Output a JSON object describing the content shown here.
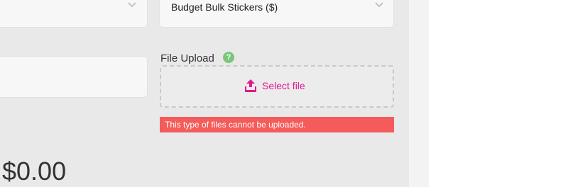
{
  "form": {
    "product_select": {
      "value": ""
    },
    "sticker_select": {
      "value": "Budget Bulk Stickers ($)"
    },
    "text_input": {
      "value": ""
    },
    "file_upload": {
      "label": "File Upload",
      "help_glyph": "?",
      "button_label": "Select file",
      "error": "This type of files cannot be uploaded."
    },
    "total": "$0.00"
  },
  "colors": {
    "accent": "#e0188c",
    "error": "#f45b5b",
    "help": "#7ac67a"
  },
  "icons": [
    "chevron-down-icon",
    "question-icon",
    "upload-icon"
  ]
}
